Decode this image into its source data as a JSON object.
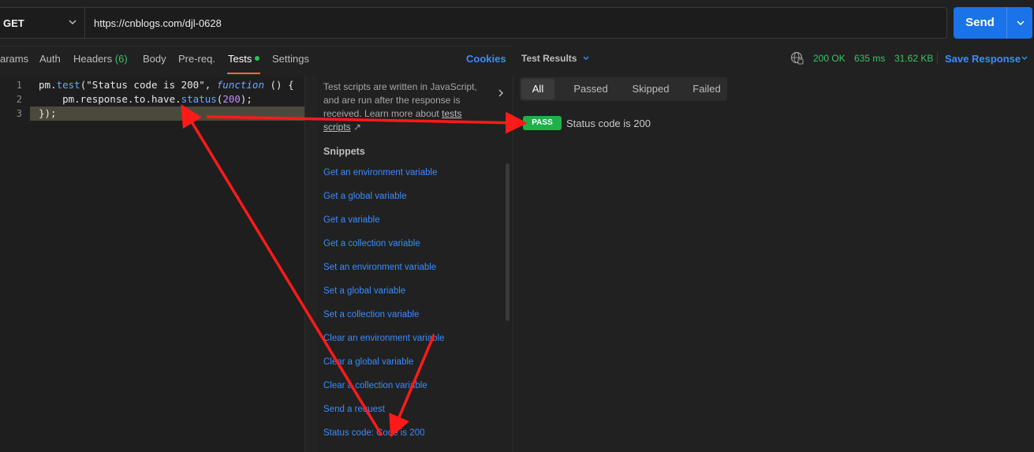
{
  "request": {
    "method": "GET",
    "url": "https://cnblogs.com/djl-0628",
    "send_label": "Send"
  },
  "tabs": [
    {
      "label": "arams"
    },
    {
      "label": "Auth"
    },
    {
      "label": "Headers",
      "count": "(6)"
    },
    {
      "label": "Body"
    },
    {
      "label": "Pre-req."
    },
    {
      "label": "Tests"
    },
    {
      "label": "Settings"
    }
  ],
  "cookies_label": "Cookies",
  "editor": {
    "line_numbers": [
      "1",
      "2",
      "3"
    ],
    "lines": [
      {
        "p1": "pm.",
        "p2": "test",
        "p3": "(\"Status code is 200\", ",
        "p4": "function",
        "p5": " () {"
      },
      {
        "p1": "    pm.response.to.have.",
        "p2": "status",
        "p3": "(",
        "p4": "200",
        "p5": ");"
      },
      {
        "p1": "});"
      }
    ]
  },
  "snippets": {
    "info_text": "Test scripts are written in JavaScript, and are run after the response is received. Learn more about",
    "info_link": "tests scripts",
    "info_link_icon": "↗",
    "header": "Snippets",
    "items": [
      "Get an environment variable",
      "Get a global variable",
      "Get a variable",
      "Get a collection variable",
      "Set an environment variable",
      "Set a global variable",
      "Set a collection variable",
      "Clear an environment variable",
      "Clear a global variable",
      "Clear a collection variable",
      "Send a request",
      "Status code: Code is 200"
    ]
  },
  "response": {
    "title": "Test Results",
    "status": "200 OK",
    "time": "635 ms",
    "size": "31.62 KB",
    "save_label": "Save Response",
    "filters": [
      "All",
      "Passed",
      "Skipped",
      "Failed"
    ],
    "results": [
      {
        "badge": "PASS",
        "name": "Status code is 200"
      }
    ]
  },
  "colors": {
    "accent_blue": "#1a73e8",
    "pass_green": "#1eb14a",
    "active_tab_underline": "#f26b3a",
    "annotation_red": "#ff1a1a"
  }
}
